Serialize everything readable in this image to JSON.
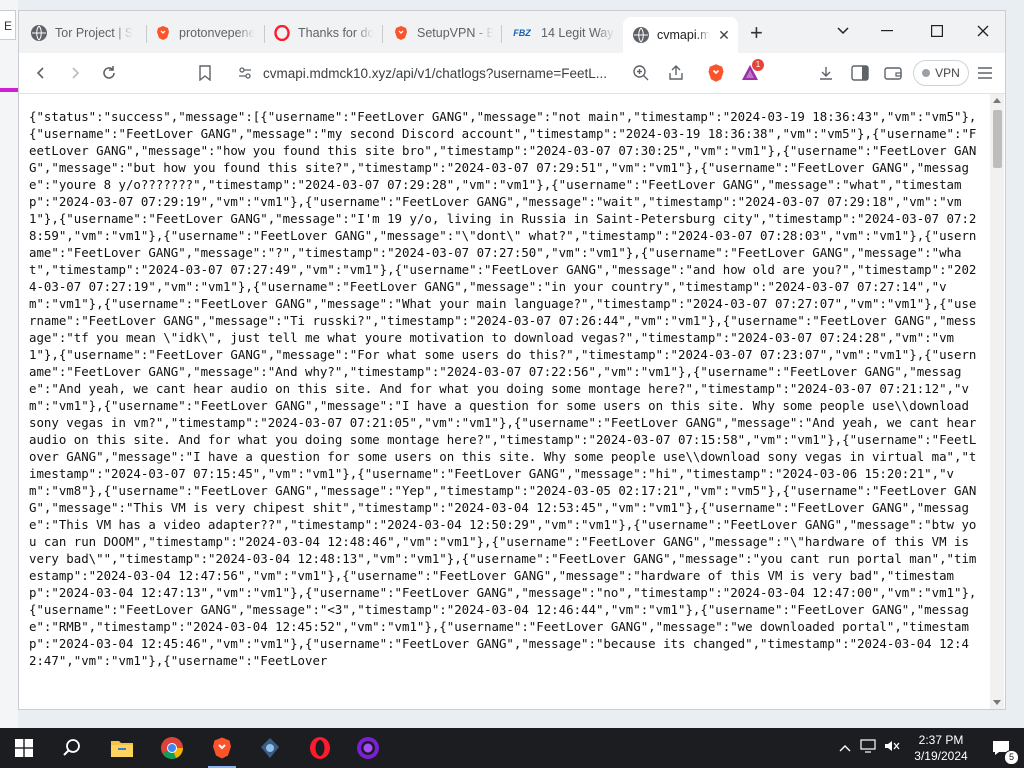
{
  "desktop": {
    "tab_letter": "E"
  },
  "tabs": [
    {
      "label": "Tor Project | S",
      "icon": "globe-icon",
      "color": "#5f6368"
    },
    {
      "label": "protonvepene",
      "icon": "brave-icon",
      "color": "#fb542b"
    },
    {
      "label": "Thanks for do",
      "icon": "opera-icon",
      "color": "#ff1b2d"
    },
    {
      "label": "SetupVPN - B",
      "icon": "brave-icon",
      "color": "#fb542b"
    },
    {
      "label": "14 Legit Ways",
      "icon": "fbz-icon",
      "favicon_text": "FBZ",
      "color": "#1a5fb4"
    },
    {
      "label": "cvmapi.m",
      "icon": "globe-icon",
      "color": "#5f6368",
      "active": true
    }
  ],
  "toolbar": {
    "url": "cvmapi.mdmck10.xyz/api/v1/chatlogs?username=FeetL...",
    "vpn_label": "VPN",
    "rewards_badge": "1"
  },
  "page": {
    "text": "{\"status\":\"success\",\"message\":[{\"username\":\"FeetLover GANG\",\"message\":\"not main\",\"timestamp\":\"2024-03-19 18:36:43\",\"vm\":\"vm5\"},{\"username\":\"FeetLover GANG\",\"message\":\"my second Discord account\",\"timestamp\":\"2024-03-19 18:36:38\",\"vm\":\"vm5\"},{\"username\":\"FeetLover GANG\",\"message\":\"how you found this site bro\",\"timestamp\":\"2024-03-07 07:30:25\",\"vm\":\"vm1\"},{\"username\":\"FeetLover GANG\",\"message\":\"but how you found this site?\",\"timestamp\":\"2024-03-07 07:29:51\",\"vm\":\"vm1\"},{\"username\":\"FeetLover GANG\",\"message\":\"youre 8 y/o???????\",\"timestamp\":\"2024-03-07 07:29:28\",\"vm\":\"vm1\"},{\"username\":\"FeetLover GANG\",\"message\":\"what\",\"timestamp\":\"2024-03-07 07:29:19\",\"vm\":\"vm1\"},{\"username\":\"FeetLover GANG\",\"message\":\"wait\",\"timestamp\":\"2024-03-07 07:29:18\",\"vm\":\"vm1\"},{\"username\":\"FeetLover GANG\",\"message\":\"I'm 19 y/o, living in Russia in Saint-Petersburg city\",\"timestamp\":\"2024-03-07 07:28:59\",\"vm\":\"vm1\"},{\"username\":\"FeetLover GANG\",\"message\":\"\\\"dont\\\" what?\",\"timestamp\":\"2024-03-07 07:28:03\",\"vm\":\"vm1\"},{\"username\":\"FeetLover GANG\",\"message\":\"?\",\"timestamp\":\"2024-03-07 07:27:50\",\"vm\":\"vm1\"},{\"username\":\"FeetLover GANG\",\"message\":\"what\",\"timestamp\":\"2024-03-07 07:27:49\",\"vm\":\"vm1\"},{\"username\":\"FeetLover GANG\",\"message\":\"and how old are you?\",\"timestamp\":\"2024-03-07 07:27:19\",\"vm\":\"vm1\"},{\"username\":\"FeetLover GANG\",\"message\":\"in your country\",\"timestamp\":\"2024-03-07 07:27:14\",\"vm\":\"vm1\"},{\"username\":\"FeetLover GANG\",\"message\":\"What your main language?\",\"timestamp\":\"2024-03-07 07:27:07\",\"vm\":\"vm1\"},{\"username\":\"FeetLover GANG\",\"message\":\"Ti russki?\",\"timestamp\":\"2024-03-07 07:26:44\",\"vm\":\"vm1\"},{\"username\":\"FeetLover GANG\",\"message\":\"tf you mean \\\"idk\\\", just tell me what youre motivation to download vegas?\",\"timestamp\":\"2024-03-07 07:24:28\",\"vm\":\"vm1\"},{\"username\":\"FeetLover GANG\",\"message\":\"For what some users do this?\",\"timestamp\":\"2024-03-07 07:23:07\",\"vm\":\"vm1\"},{\"username\":\"FeetLover GANG\",\"message\":\"And why?\",\"timestamp\":\"2024-03-07 07:22:56\",\"vm\":\"vm1\"},{\"username\":\"FeetLover GANG\",\"message\":\"And yeah, we cant hear audio on this site. And for what you doing some montage here?\",\"timestamp\":\"2024-03-07 07:21:12\",\"vm\":\"vm1\"},{\"username\":\"FeetLover GANG\",\"message\":\"I have a question for some users on this site. Why some people use\\\\download sony vegas in vm?\",\"timestamp\":\"2024-03-07 07:21:05\",\"vm\":\"vm1\"},{\"username\":\"FeetLover GANG\",\"message\":\"And yeah, we cant hear audio on this site. And for what you doing some montage here?\",\"timestamp\":\"2024-03-07 07:15:58\",\"vm\":\"vm1\"},{\"username\":\"FeetLover GANG\",\"message\":\"I have a question for some users on this site. Why some people use\\\\download sony vegas in virtual ma\",\"timestamp\":\"2024-03-07 07:15:45\",\"vm\":\"vm1\"},{\"username\":\"FeetLover GANG\",\"message\":\"hi\",\"timestamp\":\"2024-03-06 15:20:21\",\"vm\":\"vm8\"},{\"username\":\"FeetLover GANG\",\"message\":\"Yep\",\"timestamp\":\"2024-03-05 02:17:21\",\"vm\":\"vm5\"},{\"username\":\"FeetLover GANG\",\"message\":\"This VM is very chipest shit\",\"timestamp\":\"2024-03-04 12:53:45\",\"vm\":\"vm1\"},{\"username\":\"FeetLover GANG\",\"message\":\"This VM has a video adapter??\",\"timestamp\":\"2024-03-04 12:50:29\",\"vm\":\"vm1\"},{\"username\":\"FeetLover GANG\",\"message\":\"btw you can run DOOM\",\"timestamp\":\"2024-03-04 12:48:46\",\"vm\":\"vm1\"},{\"username\":\"FeetLover GANG\",\"message\":\"\\\"hardware of this VM is very bad\\\"\",\"timestamp\":\"2024-03-04 12:48:13\",\"vm\":\"vm1\"},{\"username\":\"FeetLover GANG\",\"message\":\"you cant run portal man\",\"timestamp\":\"2024-03-04 12:47:56\",\"vm\":\"vm1\"},{\"username\":\"FeetLover GANG\",\"message\":\"hardware of this VM is very bad\",\"timestamp\":\"2024-03-04 12:47:13\",\"vm\":\"vm1\"},{\"username\":\"FeetLover GANG\",\"message\":\"no\",\"timestamp\":\"2024-03-04 12:47:00\",\"vm\":\"vm1\"},{\"username\":\"FeetLover GANG\",\"message\":\"<3\",\"timestamp\":\"2024-03-04 12:46:44\",\"vm\":\"vm1\"},{\"username\":\"FeetLover GANG\",\"message\":\"RMB\",\"timestamp\":\"2024-03-04 12:45:52\",\"vm\":\"vm1\"},{\"username\":\"FeetLover GANG\",\"message\":\"we downloaded portal\",\"timestamp\":\"2024-03-04 12:45:46\",\"vm\":\"vm1\"},{\"username\":\"FeetLover GANG\",\"message\":\"because its changed\",\"timestamp\":\"2024-03-04 12:42:47\",\"vm\":\"vm1\"},{\"username\":\"FeetLover"
  },
  "taskbar": {
    "apps": [
      "file-explorer-icon",
      "chrome-icon",
      "brave-icon",
      "vpn-app-icon",
      "opera-icon",
      "opera-gx-icon"
    ],
    "time": "2:37 PM",
    "date": "3/19/2024",
    "notification_count": "5"
  }
}
